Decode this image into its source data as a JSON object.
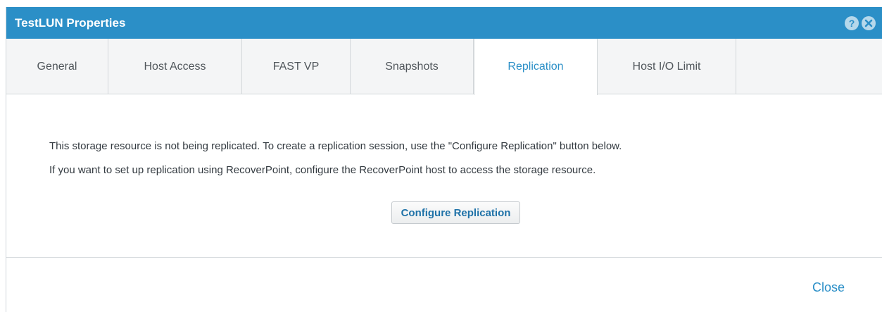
{
  "dialog": {
    "title": "TestLUN Properties",
    "help_icon": "help-icon",
    "close_icon": "close-circle-icon",
    "accent_color": "#2b8fc7"
  },
  "tabs": [
    {
      "label": "General",
      "active": false
    },
    {
      "label": "Host Access",
      "active": false
    },
    {
      "label": "FAST VP",
      "active": false
    },
    {
      "label": "Snapshots",
      "active": false
    },
    {
      "label": "Replication",
      "active": true
    },
    {
      "label": "Host I/O Limit",
      "active": false
    }
  ],
  "replication": {
    "message_line1": "This storage resource is not being replicated. To create a replication session, use the \"Configure Replication\" button below.",
    "message_line2": "If you want to set up replication using RecoverPoint, configure the RecoverPoint host to access the storage resource.",
    "configure_button": "Configure Replication"
  },
  "footer": {
    "close_label": "Close"
  }
}
